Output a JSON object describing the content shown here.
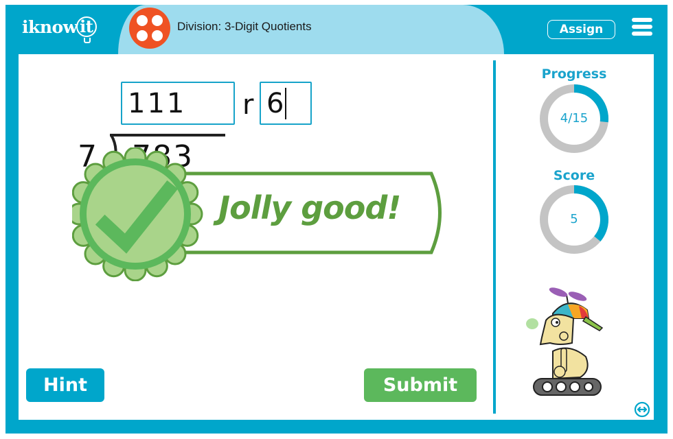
{
  "header": {
    "logo_text": "iknowit",
    "logo_icon": "lightbulb-icon",
    "topic_icon": "four-dots-icon",
    "title": "Division: 3-Digit Quotients",
    "assign_label": "Assign",
    "menu_icon": "hamburger-menu-icon"
  },
  "problem": {
    "quotient_value": "111",
    "remainder_label": "r",
    "remainder_value": "6",
    "divisor": "7",
    "dividend": "783"
  },
  "feedback": {
    "message": "Jolly good!",
    "icon": "checkmark-badge-icon"
  },
  "buttons": {
    "hint_label": "Hint",
    "submit_label": "Submit"
  },
  "sidebar": {
    "progress": {
      "label": "Progress",
      "text": "4/15",
      "current": 4,
      "total": 15
    },
    "score": {
      "label": "Score",
      "text": "5",
      "fill_fraction": 0.36
    },
    "mascot": "propeller-cap-robot",
    "expand_icon": "expand-horizontal-icon"
  },
  "colors": {
    "brand_blue": "#00a6cb",
    "light_blue": "#9edcee",
    "topic_orange": "#ef5223",
    "success_green": "#5cb85c",
    "ring_gray": "#c4c4c4"
  }
}
